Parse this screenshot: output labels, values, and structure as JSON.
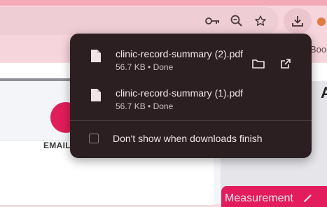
{
  "bookmarks": {
    "partial_label": "Boo"
  },
  "page": {
    "email_label": "EMAIL",
    "right_heading_partial": "A",
    "measurement_tab": "Measurement"
  },
  "downloads": {
    "items": [
      {
        "filename": "clinic-record-summary (2).pdf",
        "size": "56.7 KB",
        "status": "Done",
        "meta": "56.7 KB • Done"
      },
      {
        "filename": "clinic-record-summary (1).pdf",
        "size": "56.7 KB",
        "status": "Done",
        "meta": "56.7 KB • Done"
      }
    ],
    "checkbox_label": "Don't show when downloads finish",
    "checkbox_checked": false
  },
  "colors": {
    "bubble_bg": "#2b1f22",
    "accent": "#e31d5d",
    "chrome": "#f7d5dc"
  },
  "icons": [
    "key-icon",
    "zoom-out-icon",
    "star-icon",
    "download-icon",
    "file-icon",
    "folder-icon",
    "open-external-icon",
    "pencil-icon"
  ]
}
